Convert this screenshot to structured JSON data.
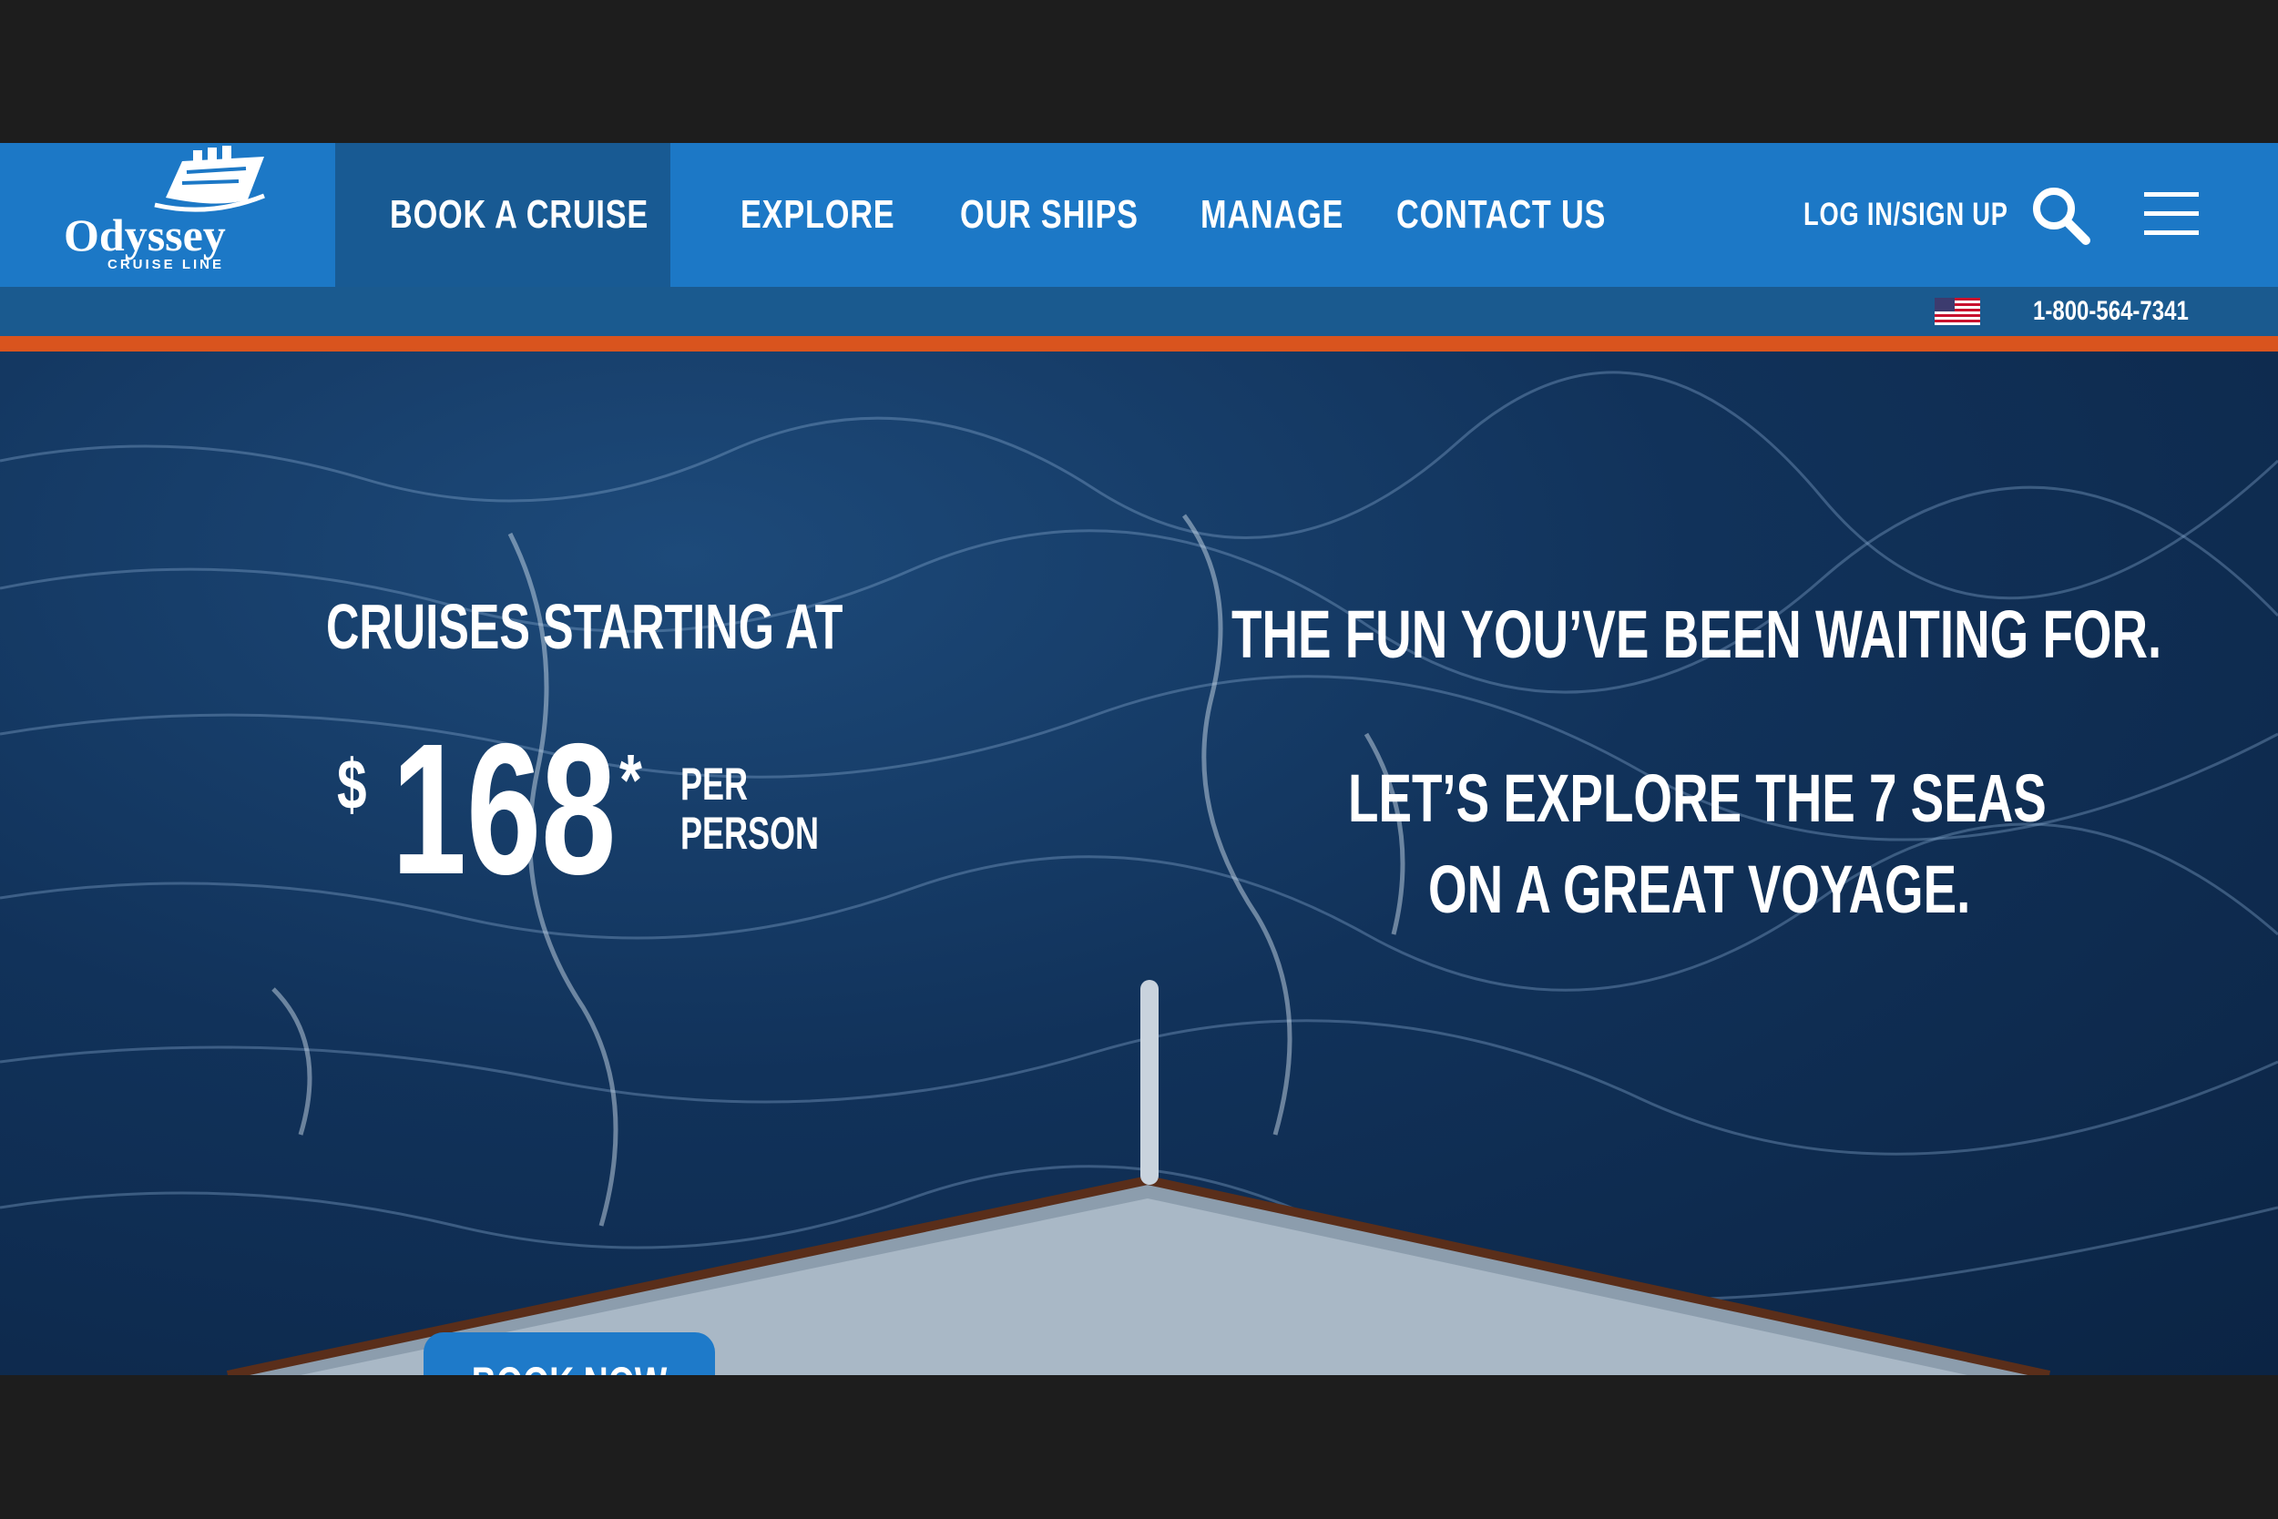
{
  "brand": {
    "name": "Odyssey",
    "tagline": "CRUISE LINE"
  },
  "nav": {
    "items": [
      {
        "label": "BOOK A CRUISE",
        "active": true
      },
      {
        "label": "EXPLORE"
      },
      {
        "label": "OUR SHIPS"
      },
      {
        "label": "MANAGE"
      },
      {
        "label": "CONTACT US"
      }
    ],
    "login_label": "LOG IN/SIGN UP",
    "search_icon": "search-icon",
    "menu_icon": "hamburger-menu-icon"
  },
  "subbar": {
    "flag_icon": "us-flag-icon",
    "phone": "1-800-564-7341"
  },
  "hero": {
    "price_intro": "CRUISES STARTING AT",
    "currency": "$",
    "price": "168",
    "asterisk": "*",
    "per_line1": "PER",
    "per_line2": "PERSON",
    "cta_label": "BOOK NOW",
    "headline": "THE FUN YOU’VE BEEN WAITING FOR.",
    "subline1": "LET’S EXPLORE THE 7 SEAS",
    "subline2": "ON A GREAT VOYAGE."
  },
  "colors": {
    "nav_blue": "#1c78c6",
    "nav_active": "#185a93",
    "subbar": "#1a5a8f",
    "accent_orange": "#d9541e",
    "cta_blue": "#1e7ac9"
  }
}
